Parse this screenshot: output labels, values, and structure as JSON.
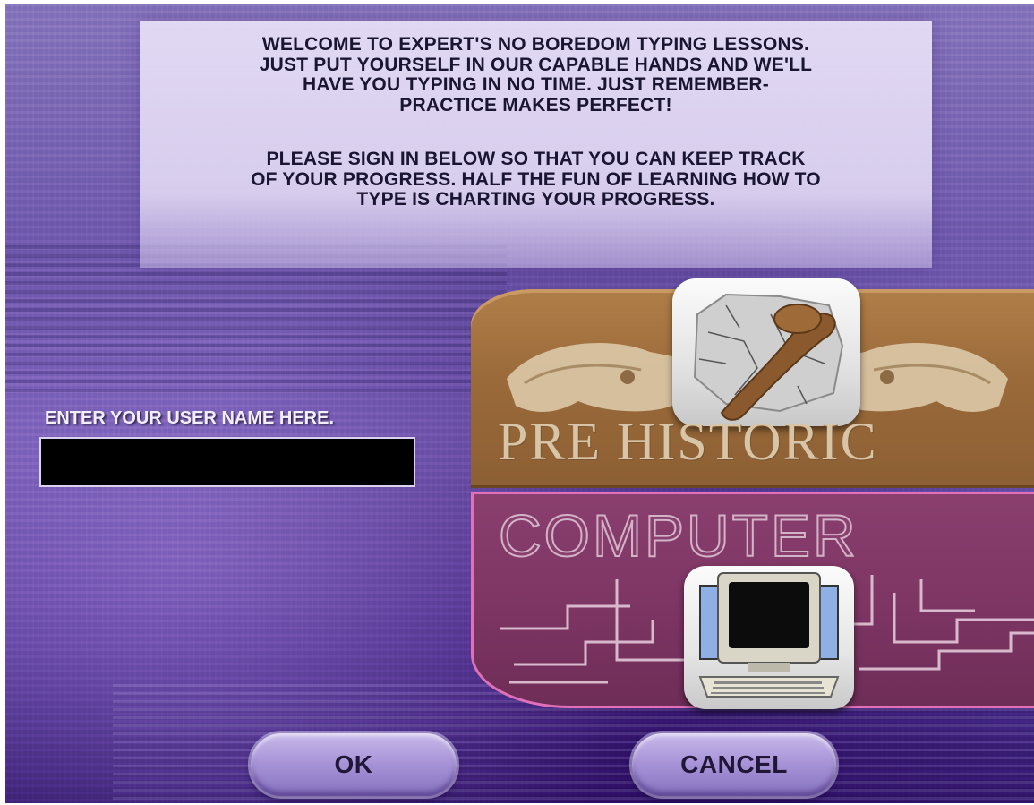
{
  "welcome": {
    "paragraph1": "WELCOME TO EXPERT'S NO BOREDOM TYPING LESSONS.\nJUST PUT YOURSELF IN OUR CAPABLE HANDS AND WE'LL\nHAVE YOU TYPING IN NO TIME.  JUST REMEMBER-\nPRACTICE MAKES PERFECT!",
    "paragraph2": "PLEASE SIGN IN BELOW SO THAT YOU CAN KEEP TRACK\nOF YOUR PROGRESS.  HALF THE FUN OF LEARNING HOW TO\nTYPE IS CHARTING YOUR PROGRESS."
  },
  "login": {
    "label": "ENTER YOUR USER NAME HERE.",
    "value": ""
  },
  "signs": {
    "prehistoric_title": "PRE HISTORIC",
    "prehistoric_icon": "club-on-stone-icon",
    "computer_title": "COMPUTER",
    "computer_icon": "desktop-computer-icon"
  },
  "buttons": {
    "ok_label": "OK",
    "cancel_label": "CANCEL"
  },
  "colors": {
    "background": "#6a55a8",
    "panel": "#e4dcf5",
    "prehistoric_sign": "#9a6a3a",
    "computer_sign": "#7d3563",
    "computer_border": "#e070b8",
    "button": "#a995d8"
  }
}
